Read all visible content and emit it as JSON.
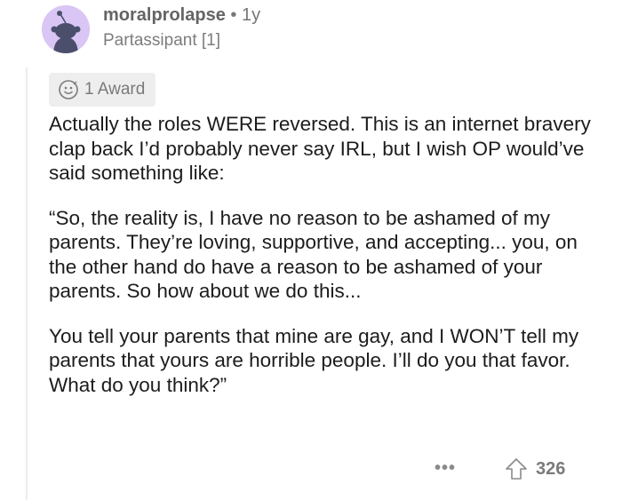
{
  "comment": {
    "author": "moralprolapse",
    "separator": "•",
    "age": "1y",
    "flair": "Partassipant [1]",
    "awards": {
      "label": "1 Award",
      "icon": "award-icon"
    },
    "paragraphs": [
      "Actually the roles WERE reversed. This is an internet bravery clap back I’d probably never say IRL, but I wish OP would’ve said something like:",
      "“So, the reality is, I have no reason to be ashamed of my parents. They’re loving, supportive, and accepting... you, on the other hand do have a reason to be ashamed of your parents. So how about we do this...",
      "You tell your parents that mine are gay, and I WON’T tell my parents that yours are horrible people. I’ll do you that favor. What do you think?”"
    ],
    "actions": {
      "more_label": "•••",
      "upvote_icon": "upvote-arrow-icon",
      "score": "326"
    }
  },
  "colors": {
    "avatar_bg": "#d9c6f4",
    "avatar_figure": "#4b4f6b",
    "meta_text": "#7c7c7c",
    "award_bg": "#eeeeee"
  }
}
